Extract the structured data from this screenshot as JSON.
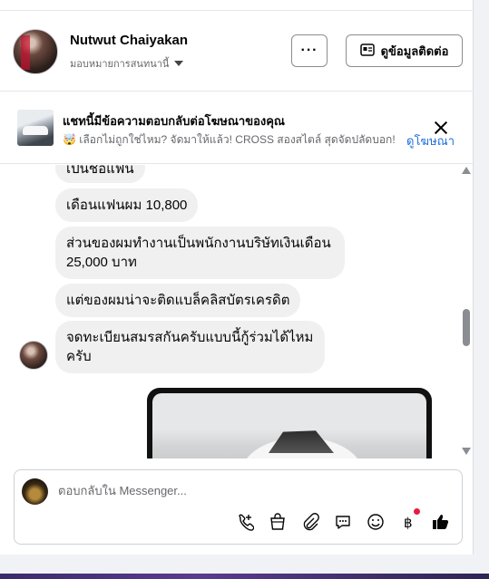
{
  "header": {
    "name": "Nutwut Chaiyakan",
    "assignment": "มอบหมายการสนทนานี้",
    "more_label": "···",
    "contact_label": "ดูข้อมูลติดต่อ"
  },
  "ad_banner": {
    "title": "แชทนี้มีข้อความตอบกลับต่อโฆษณาของคุณ",
    "subtitle": "🤯 เลือกไม่ถูกใช่ไหม? จัดมาให้แล้ว! CROSS สองสไตล์ สุดจัดปลัดบอก! ...",
    "view_ad": "ดูโฆษณา"
  },
  "messages": [
    {
      "text": "เป็นชื่อแฟน"
    },
    {
      "text": "เดือนแฟนผม 10,800"
    },
    {
      "text": "ส่วนของผมทำงานเป็นพนักงานบริษัทเงินเดือน 25,000 บาท"
    },
    {
      "text": "แต่ของผมน่าจะติดแบล็คลิสบัตรเครดิต"
    },
    {
      "text": "จดทะเบียนสมรสกันครับแบบนี้กู้ร่วมได้ไหมครับ"
    }
  ],
  "composer": {
    "placeholder": "ตอบกลับใน Messenger..."
  },
  "icons": {
    "call": "phone-add-icon",
    "shop": "shopping-bag-icon",
    "attach": "paperclip-icon",
    "saved_replies": "chat-bubble-icon",
    "emoji": "smiley-icon",
    "payment": "baht-icon",
    "like": "thumbs-up-icon"
  },
  "colors": {
    "accent": "#216fdb",
    "bubble": "#f0f0f0",
    "notification": "#e41e3f"
  }
}
